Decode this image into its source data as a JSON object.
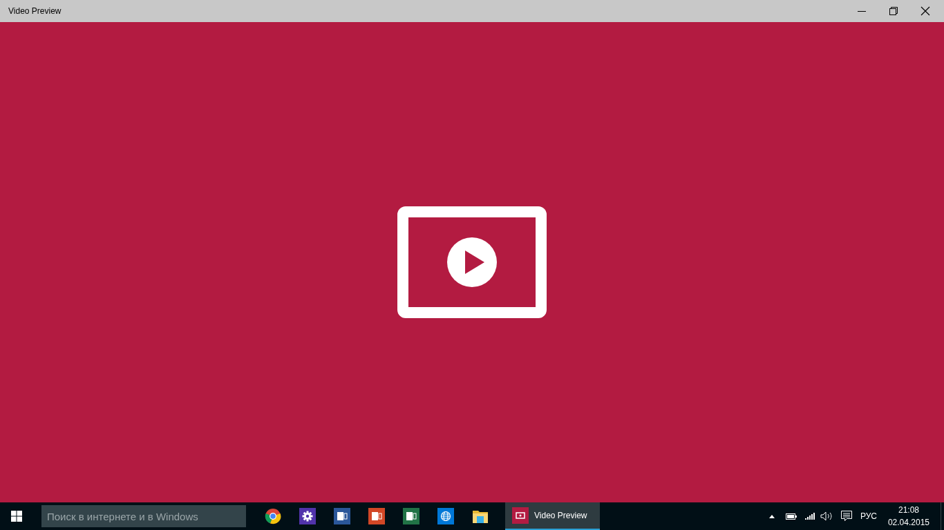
{
  "window": {
    "title": "Video Preview"
  },
  "taskbar": {
    "search": {
      "placeholder": "Поиск в интернете и в Windows"
    },
    "pinned": [
      {
        "kind": "browser"
      },
      {
        "kind": "settings"
      },
      {
        "kind": "word"
      },
      {
        "kind": "powerpoint"
      },
      {
        "kind": "excel"
      },
      {
        "kind": "globe"
      },
      {
        "kind": "folder"
      }
    ],
    "apps": [
      {
        "label": "Video Preview",
        "selected": true
      }
    ],
    "tray": {
      "language": "РУС",
      "time": "21:08",
      "date": "02.04.2015"
    }
  }
}
